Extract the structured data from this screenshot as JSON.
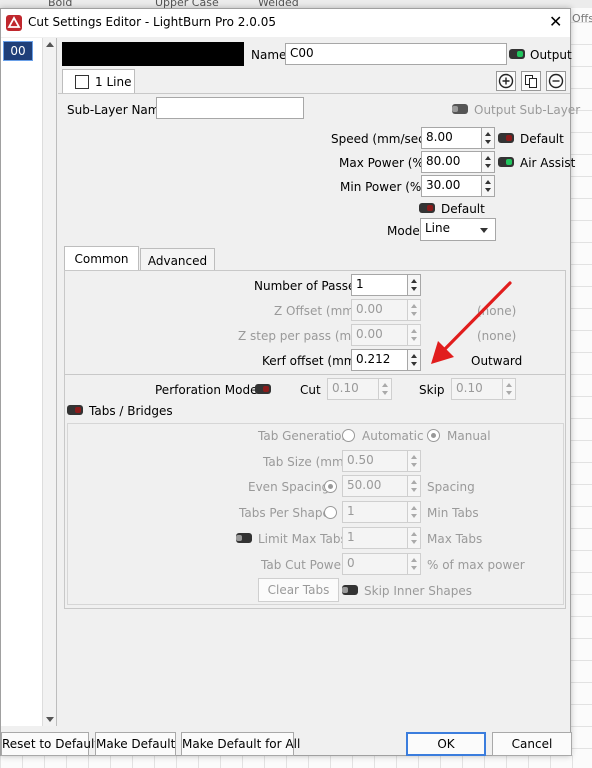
{
  "background": {
    "labels": [
      "Bold",
      "Upper Case",
      "Welded",
      "Offs"
    ]
  },
  "window": {
    "title": "Cut Settings Editor - LightBurn Pro 2.0.05"
  },
  "layer_list": {
    "selected": "00"
  },
  "header": {
    "name_label": "Name",
    "name_value": "C00",
    "output_label": "Output",
    "color_swatch": "#000000"
  },
  "subtab": {
    "label": "1 Line"
  },
  "sublayer": {
    "name_label": "Sub-Layer Name",
    "name_value": "",
    "output_sublayer_label": "Output Sub-Layer"
  },
  "params": {
    "speed_label": "Speed (mm/sec)",
    "speed_value": "8.00",
    "speed_default_label": "Default",
    "max_power_label": "Max Power (%)",
    "max_power_value": "80.00",
    "air_assist_label": "Air Assist",
    "min_power_label": "Min Power (%)",
    "min_power_value": "30.00",
    "power_default_label": "Default",
    "mode_label": "Mode",
    "mode_value": "Line"
  },
  "tabs": {
    "common": "Common",
    "advanced": "Advanced"
  },
  "common": {
    "passes_label": "Number of Passes",
    "passes_value": "1",
    "zoffset_label": "Z Offset (mm)",
    "zoffset_value": "0.00",
    "zoffset_note": "(none)",
    "zstep_label": "Z step per pass (mm)",
    "zstep_value": "0.00",
    "zstep_note": "(none)",
    "kerf_label": "Kerf offset (mm)",
    "kerf_value": "0.212",
    "kerf_note": "Outward"
  },
  "perforation": {
    "mode_label": "Perforation Mode",
    "cut_label": "Cut",
    "cut_value": "0.10",
    "skip_label": "Skip",
    "skip_value": "0.10"
  },
  "tabs_bridges": {
    "label": "Tabs / Bridges",
    "generation_label": "Tab Generation",
    "automatic_label": "Automatic",
    "manual_label": "Manual",
    "size_label": "Tab Size (mm)",
    "size_value": "0.50",
    "even_spacing_label": "Even Spacing",
    "spacing_value": "50.00",
    "spacing_label": "Spacing",
    "per_shape_label": "Tabs Per Shape",
    "min_tabs_value": "1",
    "min_tabs_label": "Min Tabs",
    "limit_max_label": "Limit Max Tabs",
    "max_tabs_value": "1",
    "max_tabs_label": "Max Tabs",
    "cut_power_label": "Tab Cut Power",
    "cut_power_value": "0",
    "cut_power_unit": "% of max power",
    "clear_tabs_label": "Clear Tabs",
    "skip_inner_label": "Skip Inner Shapes"
  },
  "footer": {
    "reset_label": "Reset to Default",
    "make_default_label": "Make Default",
    "make_default_all_label": "Make Default for All",
    "ok_label": "OK",
    "cancel_label": "Cancel"
  },
  "colors": {
    "annotation_arrow": "#e11d1d",
    "toggle_red": "#8b1b1b",
    "toggle_green": "#22c55e"
  }
}
